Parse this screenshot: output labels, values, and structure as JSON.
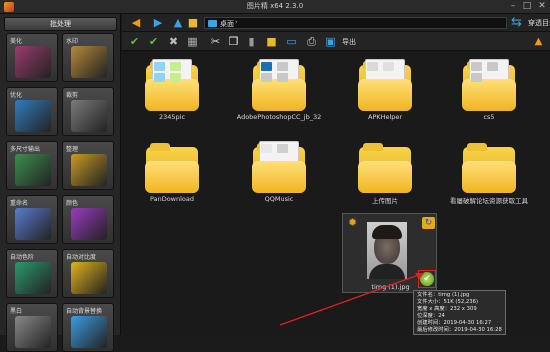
{
  "window": {
    "title": "图片精 x64 2.3.0"
  },
  "left_panel": {
    "batch_label": "批处理",
    "tiles": [
      {
        "label": "美化",
        "icon": "makeup-icon",
        "color": "#9c3b6e"
      },
      {
        "label": "水印",
        "icon": "watermark-icon",
        "color": "#b58a3a"
      },
      {
        "label": "优化",
        "icon": "optimize-icon",
        "color": "#2f7dbf"
      },
      {
        "label": "裁剪",
        "icon": "crop-icon",
        "color": "#7a7a7a"
      },
      {
        "label": "多尺寸输出",
        "icon": "resize-output-icon",
        "color": "#3a8f4f"
      },
      {
        "label": "整理",
        "icon": "organize-icon",
        "color": "#c99a24"
      },
      {
        "label": "重命名",
        "icon": "rename-icon",
        "color": "#5a7bd0"
      },
      {
        "label": "颜色",
        "icon": "color-icon",
        "color": "#9b3bbf"
      },
      {
        "label": "自动色阶",
        "icon": "auto-levels-icon",
        "color": "#2a9a6f"
      },
      {
        "label": "自动对比度",
        "icon": "auto-contrast-icon",
        "color": "#e3b21d"
      },
      {
        "label": "黑白",
        "icon": "black-white-icon",
        "color": "#888888"
      },
      {
        "label": "自动背景替换",
        "icon": "background-replace-icon",
        "color": "#3a9de0"
      }
    ]
  },
  "nav": {
    "address_text": "桌面",
    "address_chevron": "›",
    "switch_dir_label": "穿透目录"
  },
  "toolbar": {
    "export_label": "导出"
  },
  "folders": [
    {
      "name": "2345pic",
      "minis": [
        "#8fd3ff",
        "#c4f08a",
        "#8fd3ff",
        "#c4f08a"
      ]
    },
    {
      "name": "AdobePhotoshopCC_jb_32",
      "minis": [
        "#1d6fb8",
        "#c9c9c9",
        "#c9c9c9",
        "#c9c9c9"
      ]
    },
    {
      "name": "APKHelper",
      "minis": [
        "#d9d9d9",
        "#e0e0e0"
      ]
    },
    {
      "name": "cs5",
      "minis": [
        "#c9c9c9",
        "#c9c9c9",
        "#c9c9c9"
      ]
    },
    {
      "name": "PanDownload",
      "minis": []
    },
    {
      "name": "QQMusic",
      "minis": [
        "#e8e8e8",
        "#cfcfcf"
      ]
    },
    {
      "name": "上传图片",
      "minis": []
    },
    {
      "name": "看屡破解论坛资源获取工具",
      "minis": []
    }
  ],
  "selected_photo": {
    "name": "timg (1).jpg"
  },
  "tooltip": {
    "lines": [
      "文件名：timg (1).jpg",
      "文件大小：51K (52,236)",
      "宽度 x 高度：232 x 309",
      "位深度：24",
      "创建时间：2019-04-30 16:27",
      "最后修改时间：2019-04-30 16:28"
    ]
  },
  "colors": {
    "folder_yellow": "#f0b51f",
    "accent_blue": "#3aa3e0",
    "annotation_red": "#e02020"
  }
}
